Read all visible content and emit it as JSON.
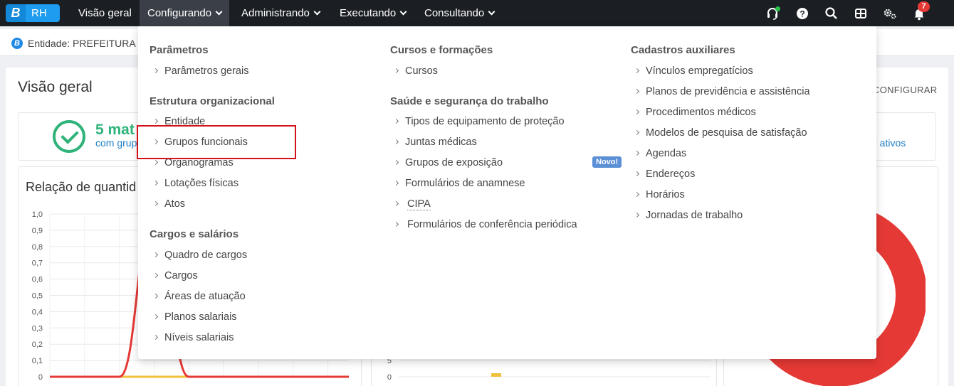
{
  "topbar": {
    "logo_letter": "B",
    "logo_text": "RH",
    "nav": [
      {
        "label": "Visão geral",
        "has_chevron": false,
        "active": false
      },
      {
        "label": "Configurando",
        "has_chevron": true,
        "active": true
      },
      {
        "label": "Administrando",
        "has_chevron": true,
        "active": false
      },
      {
        "label": "Executando",
        "has_chevron": true,
        "active": false
      },
      {
        "label": "Consultando",
        "has_chevron": true,
        "active": false
      }
    ],
    "icons": [
      "headset-icon",
      "help-icon",
      "search-icon",
      "apps-grid-icon",
      "settings-icon",
      "notifications-icon"
    ],
    "notification_count": "7"
  },
  "entity": {
    "icon_letter": "B",
    "label": "Entidade: PREFEITURA D"
  },
  "page": {
    "title": "Visão geral",
    "configure_link": "CONFIGURAR",
    "stat_number": "5 mat",
    "stat_sub": "com grup",
    "stat_right": "o ativos",
    "chart_title": "Relação de quantid"
  },
  "chart_data": [
    {
      "type": "line",
      "yticks": [
        "1,0",
        "0,9",
        "0,8",
        "0,7",
        "0,6",
        "0,5",
        "0,4",
        "0,3",
        "0,2",
        "0,1",
        "0"
      ],
      "ylim": [
        0,
        1
      ],
      "series": [
        {
          "color": "#e53935",
          "values": [
            0,
            0,
            0,
            1,
            0,
            0,
            0,
            0,
            0
          ]
        },
        {
          "color": "#f2c13b",
          "values": [
            0,
            0,
            0,
            0,
            0,
            0,
            0,
            0,
            0
          ]
        }
      ]
    },
    {
      "type": "bar",
      "yticks": [
        "5",
        "0"
      ]
    }
  ],
  "menu": {
    "columns": [
      {
        "sections": [
          {
            "title": "Parâmetros",
            "items": [
              "Parâmetros gerais"
            ]
          },
          {
            "title": "Estrutura organizacional",
            "items": [
              "Entidade",
              "Grupos funcionais",
              "Organogramas",
              "Lotações físicas",
              "Atos"
            ]
          },
          {
            "title": "Cargos e salários",
            "items": [
              "Quadro de cargos",
              "Cargos",
              "Áreas de atuação",
              "Planos salariais",
              "Níveis salariais"
            ]
          }
        ]
      },
      {
        "sections": [
          {
            "title": "Cursos e formações",
            "items": [
              "Cursos"
            ]
          },
          {
            "title": "Saúde e segurança do trabalho",
            "items": [
              "Tipos de equipamento de proteção",
              "Juntas médicas",
              "Grupos de exposição",
              "Formulários de anamnese",
              "CIPA",
              "Formulários de conferência periódica"
            ]
          }
        ]
      },
      {
        "sections": [
          {
            "title": "Cadastros auxiliares",
            "items": [
              "Vínculos empregatícios",
              "Planos de previdência e assistência",
              "Procedimentos médicos",
              "Modelos de pesquisa de satisfação",
              "Agendas",
              "Endereços",
              "Horários",
              "Jornadas de trabalho"
            ]
          }
        ]
      }
    ],
    "new_badge": "Novo!"
  },
  "colors": {
    "topbar": "#1b1f24",
    "accent_blue": "#1e9cf0",
    "success_green": "#2fb37a",
    "highlight_red": "#d4101b",
    "line_red": "#e53935"
  }
}
